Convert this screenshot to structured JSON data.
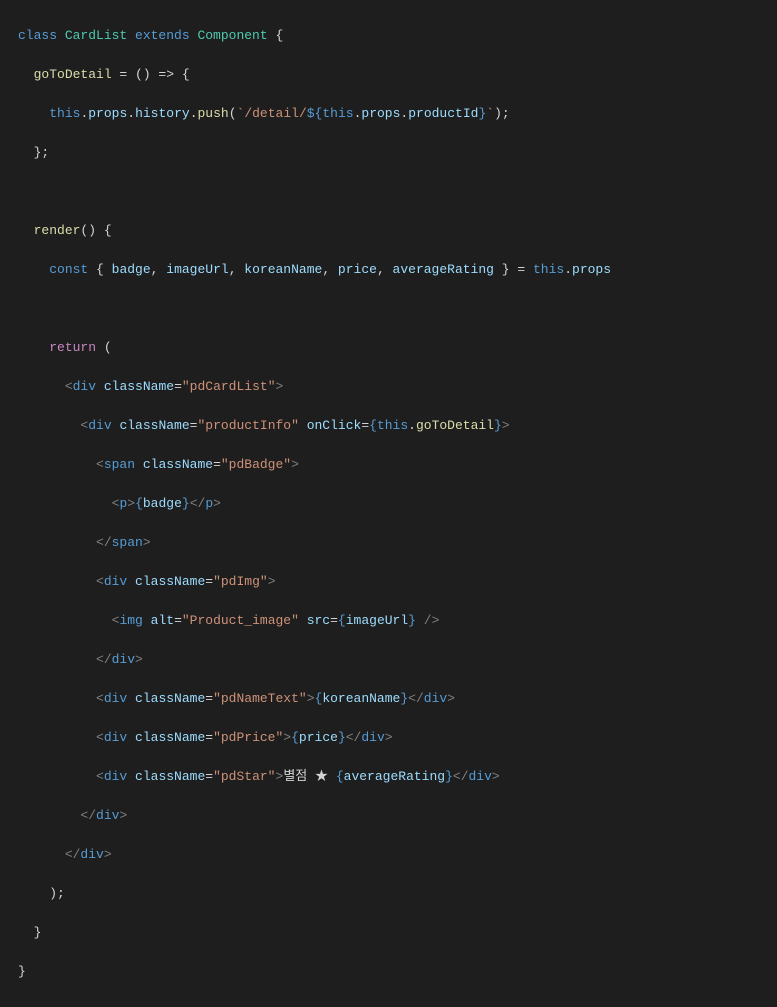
{
  "code": {
    "l1": {
      "class": "class ",
      "name": "CardList ",
      "ext": "extends ",
      "comp": "Component ",
      "ob": "{"
    },
    "l2": {
      "pad": "  ",
      "member": "goToDetail",
      "eq": " = ",
      "arrow": "() => {"
    },
    "l3": {
      "pad": "    ",
      "this": "this",
      "dot1": ".",
      "props": "props",
      "dot2": ".",
      "hist": "history",
      "dot3": ".",
      "push": "push",
      "op": "(",
      "s1": "`/detail/",
      "d1": "${",
      "this2": "this",
      "dot4": ".",
      "props2": "props",
      "dot5": ".",
      "pid": "productId",
      "d2": "}",
      "s2": "`",
      "cp": ");"
    },
    "l4": {
      "pad": "  ",
      "cb": "};"
    },
    "l6": {
      "pad": "  ",
      "render": "render",
      "sig": "() {"
    },
    "l7": {
      "pad": "    ",
      "const": "const ",
      "ob": "{ ",
      "v1": "badge",
      "c1": ", ",
      "v2": "imageUrl",
      "c2": ", ",
      "v3": "koreanName",
      "c3": ", ",
      "v4": "price",
      "c4": ", ",
      "v5": "averageRating",
      "cb": " } ",
      "eq": "= ",
      "this": "this",
      "dot": ".",
      "props": "props"
    },
    "l9": {
      "pad": "    ",
      "ret": "return ",
      "op": "("
    },
    "l10": {
      "pad": "      ",
      "o": "<",
      "tag": "div ",
      "attr": "className",
      "eq": "=",
      "val": "\"pdCardList\"",
      "c": ">"
    },
    "l11": {
      "pad": "        ",
      "o": "<",
      "tag": "div ",
      "a1": "className",
      "eq1": "=",
      "v1": "\"productInfo\" ",
      "a2": "onClick",
      "eq2": "=",
      "ob": "{",
      "this": "this",
      "dot": ".",
      "fn": "goToDetail",
      "cb": "}",
      "c": ">"
    },
    "l12": {
      "pad": "          ",
      "o": "<",
      "tag": "span ",
      "attr": "className",
      "eq": "=",
      "val": "\"pdBadge\"",
      "c": ">"
    },
    "l13": {
      "pad": "            ",
      "o": "<",
      "tag": "p",
      "c": ">",
      "ob": "{",
      "var": "badge",
      "cb": "}",
      "co": "</",
      "ctag": "p",
      "cc": ">"
    },
    "l14": {
      "pad": "          ",
      "co": "</",
      "tag": "span",
      "cc": ">"
    },
    "l15": {
      "pad": "          ",
      "o": "<",
      "tag": "div ",
      "attr": "className",
      "eq": "=",
      "val": "\"pdImg\"",
      "c": ">"
    },
    "l16": {
      "pad": "            ",
      "o": "<",
      "tag": "img ",
      "a1": "alt",
      "eq1": "=",
      "v1": "\"Product_image\" ",
      "a2": "src",
      "eq2": "=",
      "ob": "{",
      "var": "imageUrl",
      "cb": "} ",
      "sc": "/>"
    },
    "l17": {
      "pad": "          ",
      "co": "</",
      "tag": "div",
      "cc": ">"
    },
    "l18": {
      "pad": "          ",
      "o": "<",
      "tag": "div ",
      "attr": "className",
      "eq": "=",
      "val": "\"pdNameText\"",
      "c": ">",
      "ob": "{",
      "var": "koreanName",
      "cb": "}",
      "co": "</",
      "ctag": "div",
      "cc": ">"
    },
    "l19": {
      "pad": "          ",
      "o": "<",
      "tag": "div ",
      "attr": "className",
      "eq": "=",
      "val": "\"pdPrice\"",
      "c": ">",
      "ob": "{",
      "var": "price",
      "cb": "}",
      "co": "</",
      "ctag": "div",
      "cc": ">"
    },
    "l20": {
      "pad": "          ",
      "o": "<",
      "tag": "div ",
      "attr": "className",
      "eq": "=",
      "val": "\"pdStar\"",
      "c": ">",
      "txt": "별점 ★ ",
      "ob": "{",
      "var": "averageRating",
      "cb": "}",
      "co": "</",
      "ctag": "div",
      "cc": ">"
    },
    "l21": {
      "pad": "        ",
      "co": "</",
      "tag": "div",
      "cc": ">"
    },
    "l22": {
      "pad": "      ",
      "co": "</",
      "tag": "div",
      "cc": ">"
    },
    "l23": {
      "pad": "    ",
      "cp": ");"
    },
    "l24": {
      "pad": "  ",
      "cb": "}"
    },
    "l25": {
      "cb": "}"
    }
  }
}
